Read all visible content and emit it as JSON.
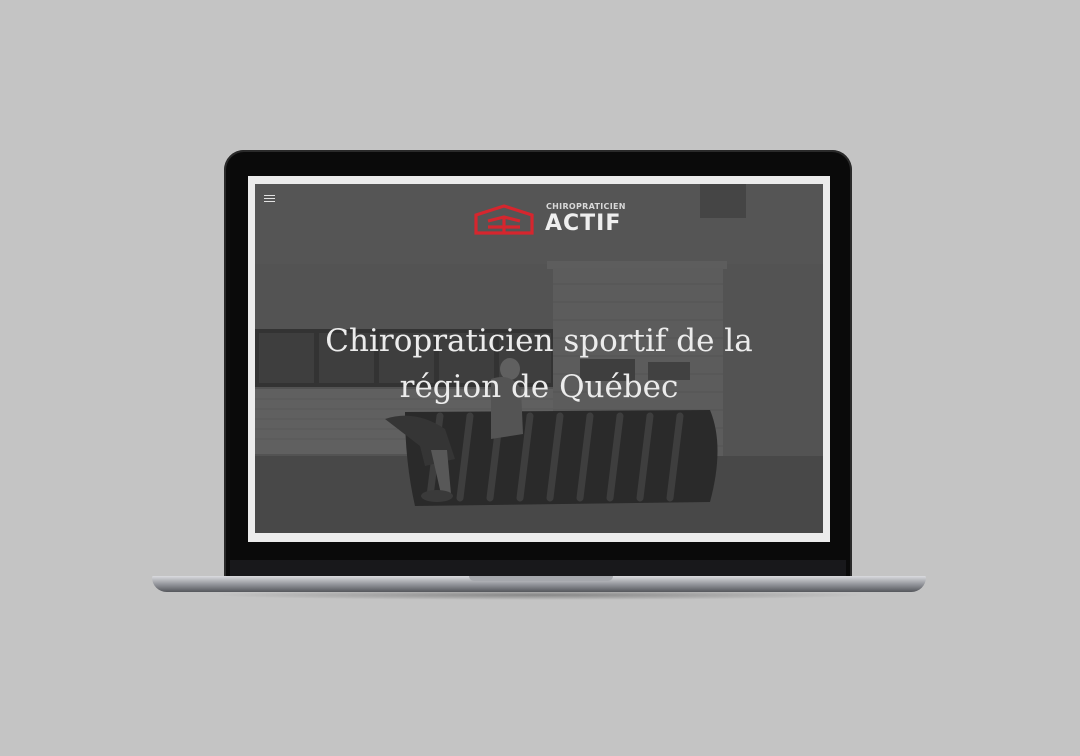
{
  "header": {
    "menu_icon": "hamburger-menu-icon",
    "logo": {
      "small_text": "CHIROPRATICIEN",
      "big_text": "ACTIF",
      "mark_icon": "chiro-logo-mark",
      "brand_color": "#d6262e"
    }
  },
  "hero": {
    "title_line1": "Chiropraticien sportif de la",
    "title_line2": "région de Québec",
    "background": "grayscale photo of a person flipping a large tractor tire in front of a garage door"
  },
  "colors": {
    "page_background": "#c4c4c4",
    "laptop_lid": "#0a0a0a",
    "hero_text": "#ececec"
  }
}
